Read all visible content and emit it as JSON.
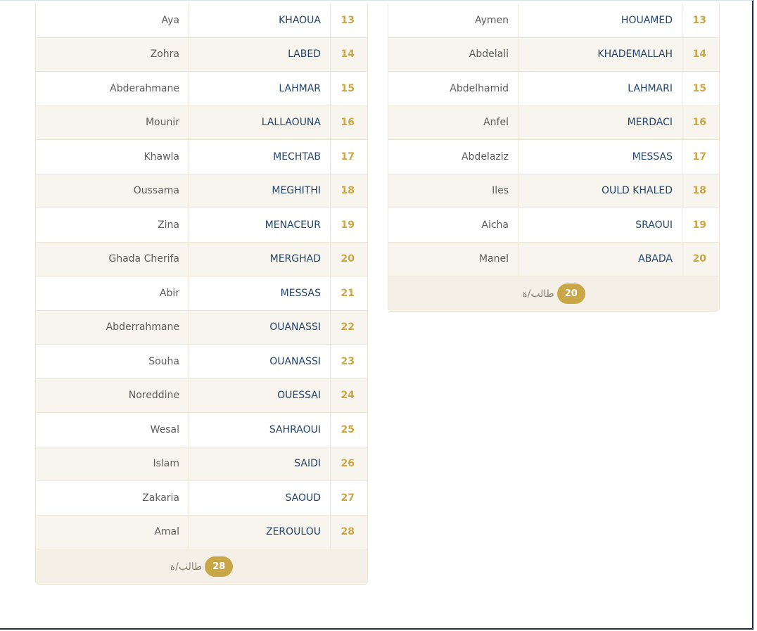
{
  "left_table": {
    "rows": [
      {
        "first": "Aya",
        "last": "KHAOUA",
        "num": "13"
      },
      {
        "first": "Zohra",
        "last": "LABED",
        "num": "14"
      },
      {
        "first": "Abderahmane",
        "last": "LAHMAR",
        "num": "15"
      },
      {
        "first": "Mounir",
        "last": "LALLAOUNA",
        "num": "16"
      },
      {
        "first": "Khawla",
        "last": "MECHTAB",
        "num": "17"
      },
      {
        "first": "Oussama",
        "last": "MEGHITHI",
        "num": "18"
      },
      {
        "first": "Zina",
        "last": "MENACEUR",
        "num": "19"
      },
      {
        "first": "Ghada Cherifa",
        "last": "MERGHAD",
        "num": "20"
      },
      {
        "first": "Abir",
        "last": "MESSAS",
        "num": "21"
      },
      {
        "first": "Abderrahmane",
        "last": "OUANASSI",
        "num": "22"
      },
      {
        "first": "Souha",
        "last": "OUANASSI",
        "num": "23"
      },
      {
        "first": "Noreddine",
        "last": "OUESSAI",
        "num": "24"
      },
      {
        "first": "Wesal",
        "last": "SAHRAOUI",
        "num": "25"
      },
      {
        "first": "Islam",
        "last": "SAIDI",
        "num": "26"
      },
      {
        "first": "Zakaria",
        "last": "SAOUD",
        "num": "27"
      },
      {
        "first": "Amal",
        "last": "ZEROULOU",
        "num": "28"
      }
    ],
    "footer": {
      "count": "28",
      "label": "طالب/ة"
    }
  },
  "right_table": {
    "rows": [
      {
        "first": "Aymen",
        "last": "HOUAMED",
        "num": "13"
      },
      {
        "first": "Abdelali",
        "last": "KHADEMALLAH",
        "num": "14"
      },
      {
        "first": "Abdelhamid",
        "last": "LAHMARI",
        "num": "15"
      },
      {
        "first": "Anfel",
        "last": "MERDACI",
        "num": "16"
      },
      {
        "first": "Abdelaziz",
        "last": "MESSAS",
        "num": "17"
      },
      {
        "first": "Iles",
        "last": "OULD KHALED",
        "num": "18"
      },
      {
        "first": "Aicha",
        "last": "SRAOUI",
        "num": "19"
      },
      {
        "first": "Manel",
        "last": "ABADA",
        "num": "20"
      }
    ],
    "footer": {
      "count": "20",
      "label": "طالب/ة"
    }
  },
  "colors": {
    "accent": "#c9a646",
    "name": "#24446a",
    "row_alt": "#f8f5ee"
  }
}
